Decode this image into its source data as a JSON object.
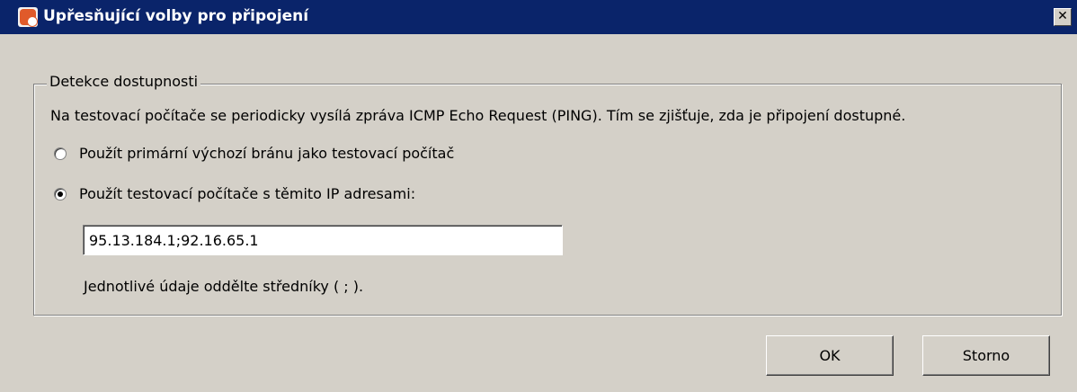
{
  "window": {
    "title": "Upřesňující volby pro připojení",
    "icon": "app-icon",
    "close_glyph": "✕"
  },
  "group": {
    "legend": "Detekce dostupnosti",
    "description": "Na testovací počítače se periodicky vysílá zpráva ICMP Echo Request (PING). Tím se zjišťuje, zda je připojení dostupné.",
    "options": [
      {
        "label": "Použít primární výchozí bránu jako testovací počítač",
        "selected": false
      },
      {
        "label": "Použít testovací počítače s těmito IP adresami:",
        "selected": true
      }
    ],
    "ip_value": "95.13.184.1;92.16.65.1",
    "hint": "Jednotlivé údaje oddělte středníky ( ; )."
  },
  "buttons": {
    "ok": "OK",
    "cancel": "Storno"
  },
  "colors": {
    "titlebar": "#0a246a",
    "dialog_bg": "#d4d0c8"
  }
}
